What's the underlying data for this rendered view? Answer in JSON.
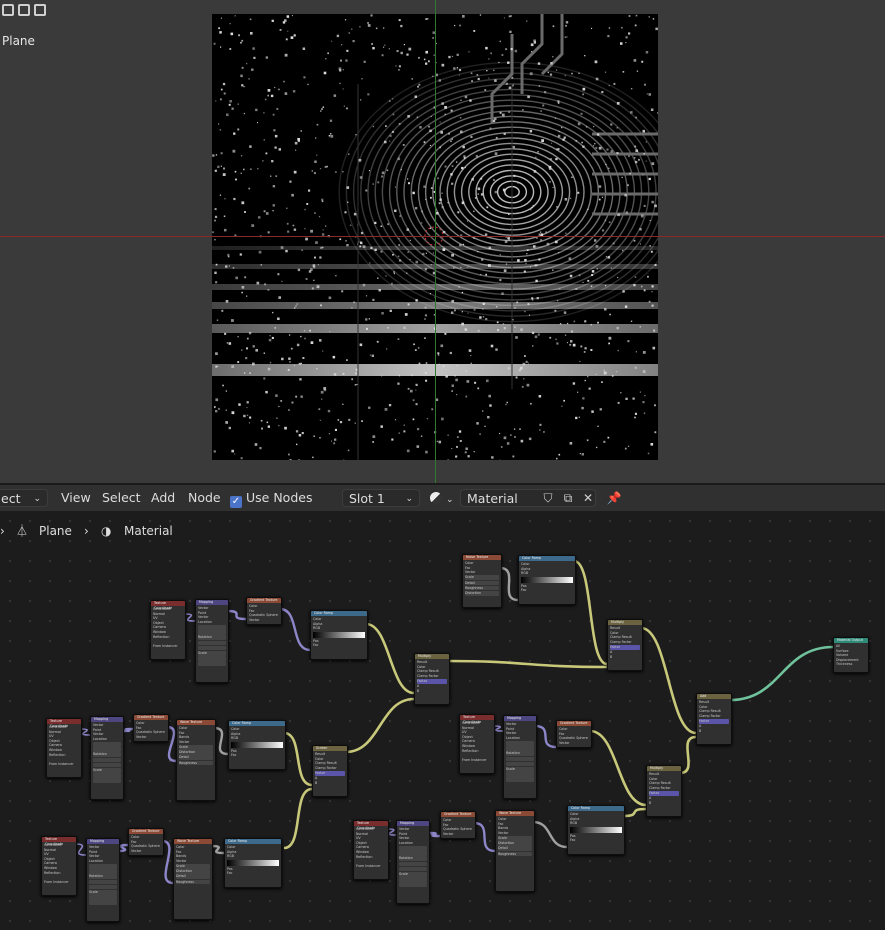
{
  "viewport": {
    "object_name": "Plane",
    "tool_icons": [
      "box-select-icon",
      "select-icon",
      "lasso-icon"
    ]
  },
  "header": {
    "select_menu": "ect",
    "view_menu": "View",
    "select_label": "Select",
    "add_menu": "Add",
    "node_menu": "Node",
    "use_nodes_label": "Use Nodes",
    "use_nodes_checked": true,
    "slot": "Slot 1",
    "material_name": "Material"
  },
  "breadcrumb": {
    "object": "Plane",
    "material": "Material"
  },
  "nodes": {
    "texcoord": "Texture Coordinate",
    "mapping": "Mapping",
    "gradient": "Gradient Texture",
    "noise": "Noise Texture",
    "colorramp": "Color Ramp",
    "wave": "Wave Texture",
    "mix": "Multiply",
    "add": "Add",
    "screen": "Screen",
    "output": "Material Output",
    "lbl_generated": "Generated",
    "lbl_normal": "Normal",
    "lbl_uv": "UV",
    "lbl_object": "Object",
    "lbl_camera": "Camera",
    "lbl_window": "Window",
    "lbl_reflection": "Reflection",
    "lbl_from_instancer": "From Instancer",
    "lbl_vector": "Vector",
    "lbl_point": "Point",
    "lbl_location": "Location",
    "lbl_rotation": "Rotation",
    "lbl_scale": "Scale",
    "lbl_quadratic": "Quadratic Sphere",
    "lbl_color": "Color",
    "lbl_fac": "Fac",
    "lbl_alpha": "Alpha",
    "lbl_rgb": "RGB",
    "lbl_pos": "Pos",
    "lbl_result": "Result",
    "lbl_clamp": "Clamp Result",
    "lbl_clamp_factor": "Clamp Factor",
    "lbl_factor": "Factor",
    "lbl_bands": "Bands",
    "lbl_distortion": "Distortion",
    "lbl_detail": "Detail",
    "lbl_roughness": "Roughness",
    "lbl_surface": "Surface",
    "lbl_volume": "Volume",
    "lbl_displacement": "Displacement",
    "lbl_thickness": "Thickness",
    "lbl_all": "All",
    "lbl_spherical": "Spherical",
    "lbl_b_spline": "B-Spline",
    "lbl_linear": "Linear",
    "lbl_constant": "Constant"
  },
  "colors": {
    "accent": "#4b74c9",
    "link_yellow": "#c8c87a",
    "link_purple": "#8d86c9",
    "link_gray": "#a0a0a0",
    "link_green": "#6fc29c"
  }
}
